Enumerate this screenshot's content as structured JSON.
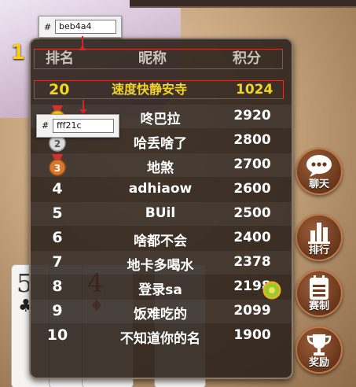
{
  "background": {
    "partial_digit": "1",
    "cards": [
      {
        "rank": "5",
        "suit": "♣",
        "red": false
      },
      {
        "rank": "",
        "suit": "",
        "red": false
      },
      {
        "rank": "4",
        "suit": "♦",
        "red": true
      },
      {
        "rank": "",
        "suit": "",
        "red": true
      }
    ]
  },
  "leaderboard": {
    "header": {
      "rank": "排名",
      "nickname": "昵称",
      "score": "积分"
    },
    "self_row": {
      "rank": "20",
      "name": "速度快静安寺",
      "score": "1024"
    },
    "rows": [
      {
        "rank": "1",
        "medal": "gold",
        "name": "咚巴拉",
        "score": "2920"
      },
      {
        "rank": "2",
        "medal": "silver",
        "name": "哈丢啥了",
        "score": "2800"
      },
      {
        "rank": "3",
        "medal": "bronze",
        "name": "地煞",
        "score": "2700"
      },
      {
        "rank": "4",
        "medal": "",
        "name": "adhiaow",
        "score": "2600"
      },
      {
        "rank": "5",
        "medal": "",
        "name": "BUil",
        "score": "2500"
      },
      {
        "rank": "6",
        "medal": "",
        "name": "啥都不会",
        "score": "2400"
      },
      {
        "rank": "7",
        "medal": "",
        "name": "地卡多喝水",
        "score": "2378"
      },
      {
        "rank": "8",
        "medal": "",
        "name": "登录sa",
        "score": "2198"
      },
      {
        "rank": "9",
        "medal": "",
        "name": "饭难吃的",
        "score": "2099"
      },
      {
        "rank": "10",
        "medal": "",
        "name": "不知道你的名",
        "score": "1900"
      }
    ]
  },
  "side_buttons": [
    {
      "label": "聊天",
      "icon": "chat-bubble-icon"
    },
    {
      "label": "排行",
      "icon": "bar-chart-icon"
    },
    {
      "label": "赛制",
      "icon": "notepad-icon"
    },
    {
      "label": "奖励",
      "icon": "trophy-icon"
    }
  ],
  "color_tips": [
    {
      "hash": "#",
      "value": "beb4a4"
    },
    {
      "hash": "#",
      "value": "fff21c"
    }
  ],
  "colors": {
    "panel_bg": "#2c221c",
    "header_text": "#beb4a4",
    "self_row_text": "#fff21c",
    "highlight_border": "#c83a2a",
    "button_brown": "#6e3a1e"
  }
}
